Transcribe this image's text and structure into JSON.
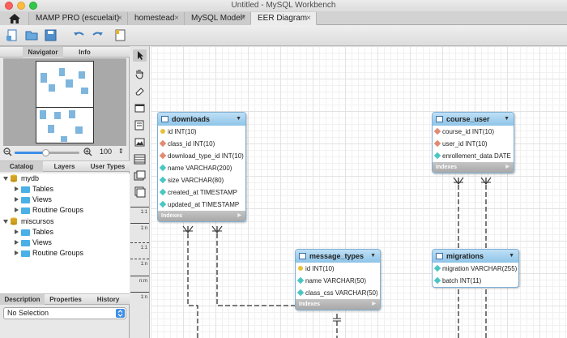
{
  "window": {
    "title": "Untitled - MySQL Workbench"
  },
  "tabs": [
    {
      "label": "MAMP PRO (escuelait)"
    },
    {
      "label": "homestead"
    },
    {
      "label": "MySQL Model*"
    },
    {
      "label": "EER Diagram"
    }
  ],
  "tab_close": "×",
  "left_top_tabs": {
    "navigator": "Navigator",
    "info": "Info"
  },
  "zoom": {
    "value": "100",
    "stepper": "⇕"
  },
  "left_mid_tabs": {
    "catalog": "Catalog",
    "layers": "Layers",
    "user_types": "User Types"
  },
  "catalog": {
    "schemas": [
      {
        "name": "mydb",
        "children": [
          "Tables",
          "Views",
          "Routine Groups"
        ]
      },
      {
        "name": "miscursos",
        "children": [
          "Tables",
          "Views",
          "Routine Groups"
        ]
      }
    ]
  },
  "left_bottom_tabs": {
    "description": "Description",
    "properties": "Properties",
    "history": "History"
  },
  "selection": {
    "value": "No Selection"
  },
  "relationship_tools": [
    "1:1",
    "1:n",
    "1:1",
    "1:n",
    "n:m",
    "1:n"
  ],
  "indexes_label": "Indexes",
  "tables": [
    {
      "name": "downloads",
      "columns": [
        {
          "kind": "pk",
          "text": "id INT(10)"
        },
        {
          "kind": "fk",
          "text": "class_id INT(10)"
        },
        {
          "kind": "fk",
          "text": "download_type_id INT(10)"
        },
        {
          "kind": "nn",
          "text": "name VARCHAR(200)"
        },
        {
          "kind": "nn",
          "text": "size VARCHAR(80)"
        },
        {
          "kind": "nn",
          "text": "created_at TIMESTAMP"
        },
        {
          "kind": "nn",
          "text": "updated_at TIMESTAMP"
        }
      ]
    },
    {
      "name": "course_user",
      "columns": [
        {
          "kind": "fk",
          "text": "course_id INT(10)"
        },
        {
          "kind": "fk",
          "text": "user_id INT(10)"
        },
        {
          "kind": "nn",
          "text": "enrollement_data DATE"
        }
      ]
    },
    {
      "name": "message_types",
      "columns": [
        {
          "kind": "pk",
          "text": "id INT(10)"
        },
        {
          "kind": "nn",
          "text": "name VARCHAR(50)"
        },
        {
          "kind": "nn",
          "text": "class_css VARCHAR(50)"
        }
      ]
    },
    {
      "name": "migrations",
      "columns": [
        {
          "kind": "nn",
          "text": "migration VARCHAR(255)"
        },
        {
          "kind": "nn",
          "text": "batch INT(11)"
        }
      ]
    }
  ],
  "colors": {
    "table_header": "#8ec4e8",
    "accent": "#3d8ee8",
    "folder": "#4ab0e6"
  }
}
